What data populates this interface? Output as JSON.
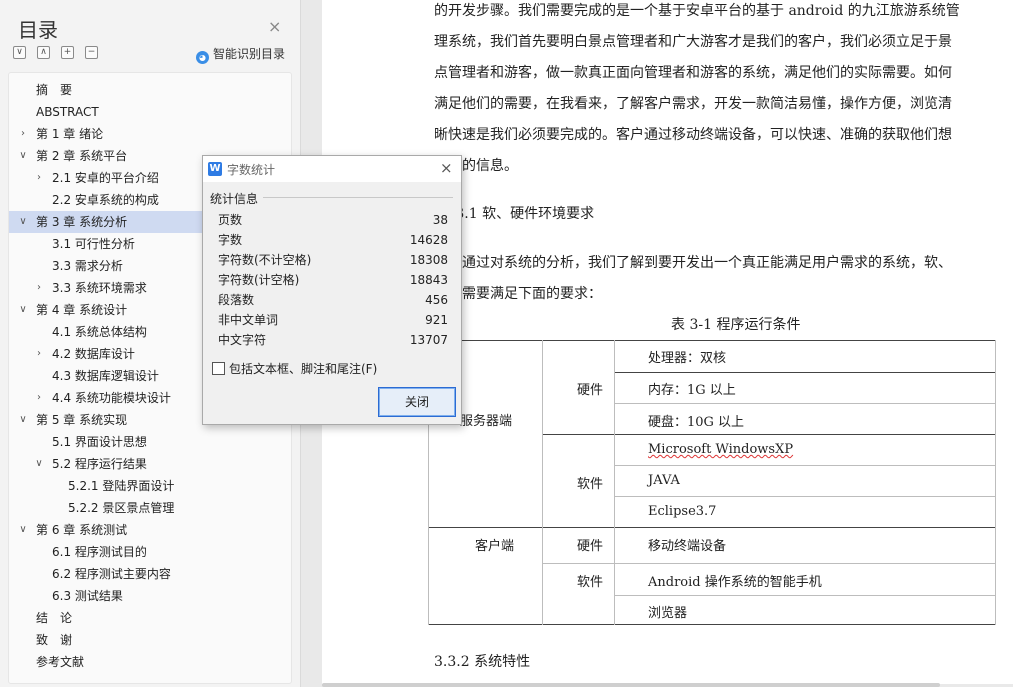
{
  "nav": {
    "title": "目录",
    "close": "×",
    "toolbar": [
      "∨",
      "∧",
      "+",
      "−"
    ],
    "smart_toc": "智能识别目录",
    "items": [
      {
        "label": "摘　要",
        "level": 0,
        "arrow": "",
        "selected": false
      },
      {
        "label": "ABSTRACT",
        "level": 0,
        "arrow": "",
        "selected": false
      },
      {
        "label": "第 1 章  绪论",
        "level": 0,
        "arrow": "›",
        "selected": false
      },
      {
        "label": "第 2 章  系统平台",
        "level": 0,
        "arrow": "∨",
        "selected": false
      },
      {
        "label": "2.1  安卓的平台介绍",
        "level": 1,
        "arrow": "›",
        "selected": false
      },
      {
        "label": "2.2 安卓系统的构成",
        "level": 1,
        "arrow": "",
        "selected": false
      },
      {
        "label": "第 3 章  系统分析",
        "level": 0,
        "arrow": "∨",
        "selected": true
      },
      {
        "label": "3.1 可行性分析",
        "level": 1,
        "arrow": "",
        "selected": false
      },
      {
        "label": "3.3  需求分析",
        "level": 1,
        "arrow": "",
        "selected": false
      },
      {
        "label": "3.3  系统环境需求",
        "level": 1,
        "arrow": "›",
        "selected": false
      },
      {
        "label": "第 4 章  系统设计",
        "level": 0,
        "arrow": "∨",
        "selected": false
      },
      {
        "label": "4.1 系统总体结构",
        "level": 1,
        "arrow": "",
        "selected": false
      },
      {
        "label": "4.2 数据库设计",
        "level": 1,
        "arrow": "›",
        "selected": false
      },
      {
        "label": "4.3 数据库逻辑设计",
        "level": 1,
        "arrow": "",
        "selected": false
      },
      {
        "label": "4.4 系统功能模块设计",
        "level": 1,
        "arrow": "›",
        "selected": false
      },
      {
        "label": "第 5 章  系统实现",
        "level": 0,
        "arrow": "∨",
        "selected": false
      },
      {
        "label": "5.1  界面设计思想",
        "level": 1,
        "arrow": "",
        "selected": false
      },
      {
        "label": "5.2 程序运行结果",
        "level": 1,
        "arrow": "∨",
        "selected": false
      },
      {
        "label": "5.2.1  登陆界面设计",
        "level": 2,
        "arrow": "",
        "selected": false
      },
      {
        "label": "5.2.2 景区景点管理",
        "level": 2,
        "arrow": "",
        "selected": false
      },
      {
        "label": "第 6 章  系统测试",
        "level": 0,
        "arrow": "∨",
        "selected": false
      },
      {
        "label": "6.1  程序测试目的",
        "level": 1,
        "arrow": "",
        "selected": false
      },
      {
        "label": "6.2  程序测试主要内容",
        "level": 1,
        "arrow": "",
        "selected": false
      },
      {
        "label": "6.3 测试结果",
        "level": 1,
        "arrow": "",
        "selected": false
      },
      {
        "label": "结　论",
        "level": 0,
        "arrow": "",
        "selected": false
      },
      {
        "label": "致　谢",
        "level": 0,
        "arrow": "",
        "selected": false
      },
      {
        "label": "参考文献",
        "level": 0,
        "arrow": "",
        "selected": false
      }
    ]
  },
  "doc": {
    "para1": [
      "的开发步骤。我们需要完成的是一个基于安卓平台的基于 android 的九江旅游系统管",
      "理系统，我们首先要明白景点管理者和广大游客才是我们的客户，我们必须立足于景",
      "点管理者和游客，做一款真正面向管理者和游客的系统，满足他们的实际需要。如何",
      "满足他们的需要，在我看来，了解客户需求，开发一款简洁易懂，操作方便，浏览清",
      "晰快速是我们必须要完成的。客户通过移动终端设备，可以快速、准确的获取他们想",
      "得到的信息。"
    ],
    "heading331": "3.3.1  软、硬件环境要求",
    "para2": [
      "通过对系统的分析，我们了解到要开发出一个真正能满足用户需求的系统，软、",
      "硬件需要满足下面的要求："
    ],
    "table_caption": "表 3-1  程序运行条件",
    "table": {
      "server": "服务器端",
      "client": "客户端",
      "hardware": "硬件",
      "software": "软件",
      "server_hw": [
        "处理器：双核",
        "内存：1G 以上",
        "硬盘：10G 以上"
      ],
      "server_sw": [
        "Microsoft WindowsXP",
        "JAVA",
        "Eclipse3.7"
      ],
      "client_hw": "移动终端设备",
      "client_sw": [
        "Android 操作系统的智能手机",
        "浏览器"
      ]
    },
    "heading332": "3.3.2  系统特性"
  },
  "dialog": {
    "title": "字数统计",
    "close": "×",
    "section": "统计信息",
    "stats": [
      {
        "label": "页数",
        "value": "38"
      },
      {
        "label": "字数",
        "value": "14628"
      },
      {
        "label": "字符数(不计空格)",
        "value": "18308"
      },
      {
        "label": "字符数(计空格)",
        "value": "18843"
      },
      {
        "label": "段落数",
        "value": "456"
      },
      {
        "label": "非中文单词",
        "value": "921"
      },
      {
        "label": "中文字符",
        "value": "13707"
      }
    ],
    "include_label": "包括文本框、脚注和尾注(F)",
    "include_checked": false,
    "close_button": "关闭"
  }
}
